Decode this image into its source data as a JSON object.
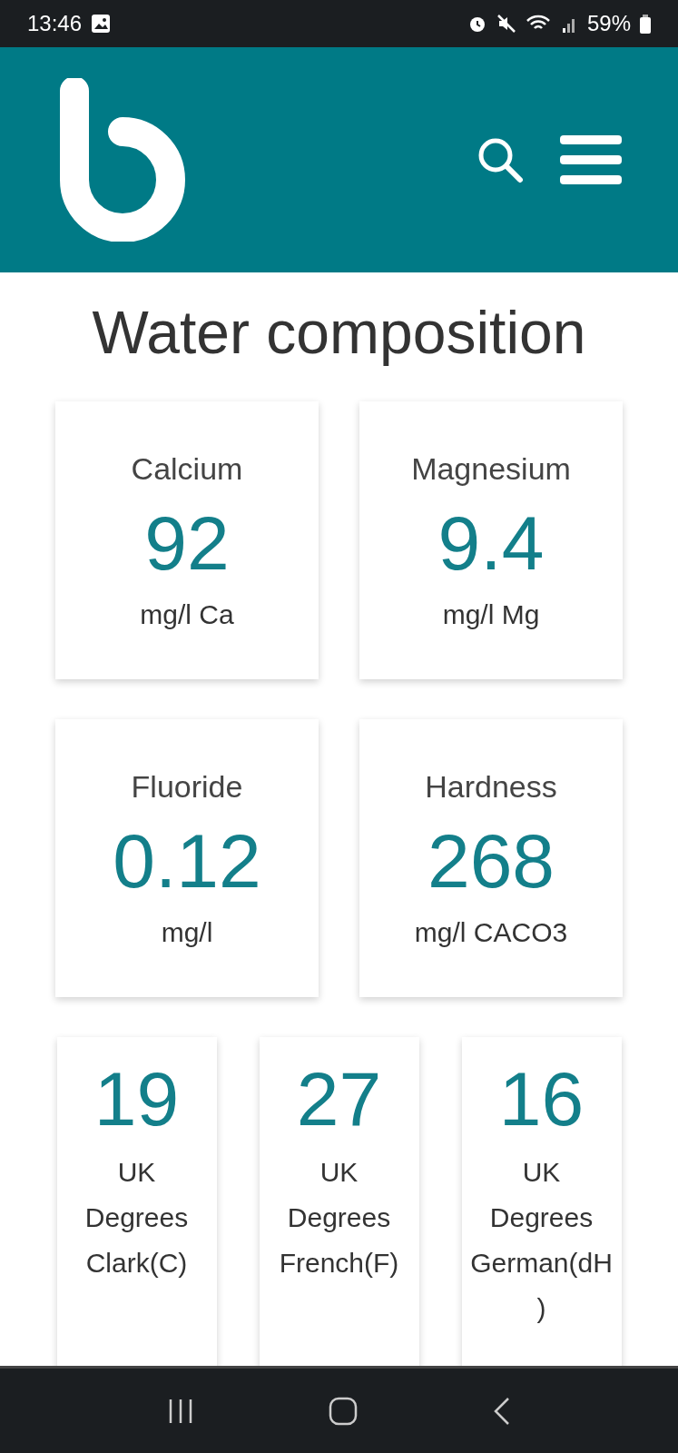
{
  "status_bar": {
    "time": "13:46",
    "battery": "59%"
  },
  "title": "Water composition",
  "minerals": [
    {
      "name": "Calcium",
      "value": "92",
      "unit": "mg/l Ca"
    },
    {
      "name": "Magnesium",
      "value": "9.4",
      "unit": "mg/l Mg"
    },
    {
      "name": "Fluoride",
      "value": "0.12",
      "unit": "mg/l"
    },
    {
      "name": "Hardness",
      "value": "268",
      "unit": "mg/l CACO3"
    }
  ],
  "degrees": [
    {
      "value": "19",
      "unit": "UK Degrees Clark(C)"
    },
    {
      "value": "27",
      "unit": "UK Degrees French(F)"
    },
    {
      "value": "16",
      "unit": "UK Degrees German(dH)"
    }
  ]
}
